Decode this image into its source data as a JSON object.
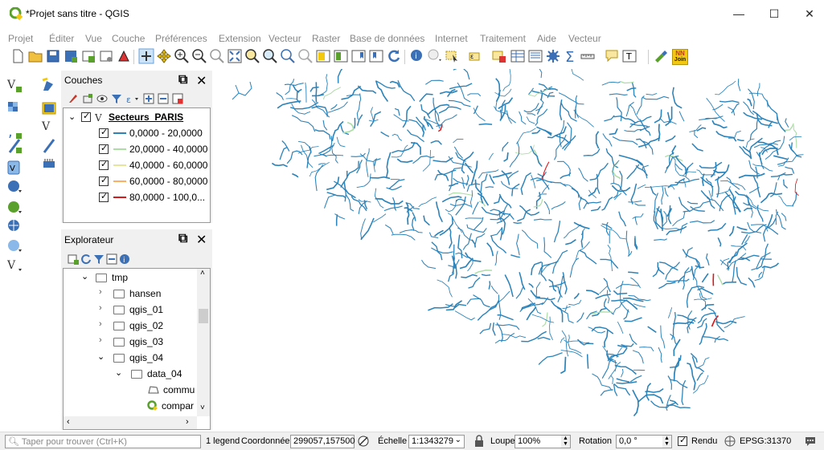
{
  "window": {
    "title": "*Projet sans titre - QGIS",
    "minimize": "—",
    "maximize": "☐",
    "close": "✕"
  },
  "menu": [
    "Projet",
    "Éditer",
    "Vue",
    "Couche",
    "Préférences",
    "Extension",
    "Vecteur",
    "Raster",
    "Base de données",
    "Internet",
    "Traitement",
    "Aide",
    "Vecteur"
  ],
  "layers_panel": {
    "title": "Couches",
    "layer_name": "Secteurs_PARIS",
    "classes": [
      {
        "label": "0,0000 - 20,0000",
        "color": "#2b83ba"
      },
      {
        "label": "20,0000 - 40,0000",
        "color": "#abdda4"
      },
      {
        "label": "40,0000 - 60,0000",
        "color": "#ffffbf"
      },
      {
        "label": "60,0000 - 80,0000",
        "color": "#fdae61"
      },
      {
        "label": "80,0000 - 100,0...",
        "color": "#d7191c"
      }
    ]
  },
  "browser_panel": {
    "title": "Explorateur",
    "items": [
      {
        "label": "tmp",
        "expanded": true
      },
      {
        "label": "hansen"
      },
      {
        "label": "qgis_01"
      },
      {
        "label": "qgis_02"
      },
      {
        "label": "qgis_03"
      },
      {
        "label": "qgis_04",
        "expanded": true
      },
      {
        "label": "data_04",
        "expanded": true
      },
      {
        "label": "commu"
      },
      {
        "label": "compar"
      }
    ]
  },
  "toolbar_badge": {
    "line1": "NN",
    "line2": "Join"
  },
  "statusbar": {
    "search_placeholder": "Taper pour trouver (Ctrl+K)",
    "legend_msg": "1 legend",
    "coord_label": "Coordonnée",
    "coord_value": "299057,157500",
    "scale_label": "Échelle",
    "scale_value": "1:1343279",
    "magnifier_label": "Loupe",
    "magnifier_value": "100%",
    "rotation_label": "Rotation",
    "rotation_value": "0,0 °",
    "render_label": "Rendu",
    "crs": "EPSG:31370"
  },
  "colors": {
    "river": "#2b83ba",
    "accent_green": "#5aa02c"
  }
}
